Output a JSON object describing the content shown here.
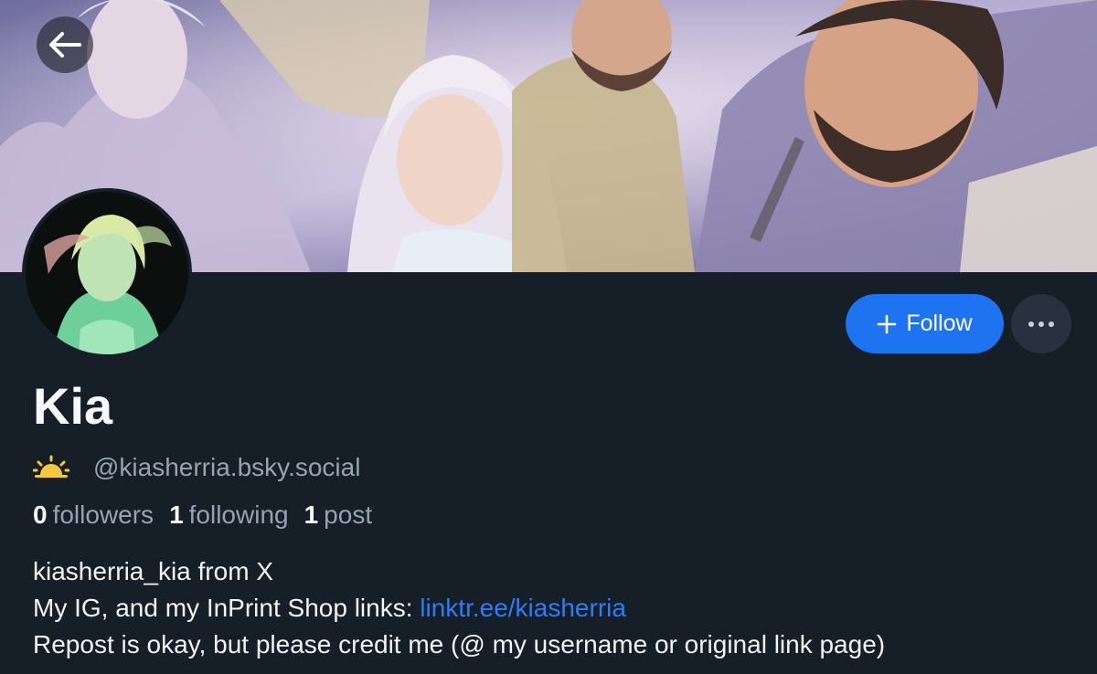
{
  "nav": {
    "back_icon": "arrow-left-icon"
  },
  "banner": {
    "description_icon": "banner-image"
  },
  "profile": {
    "display_name": "Kia",
    "handle_icon": "sun-badge-icon",
    "handle": "@kiasherria.bsky.social",
    "stats": {
      "followers_count": "0",
      "followers_label": "followers",
      "following_count": "1",
      "following_label": "following",
      "posts_count": "1",
      "posts_label": "post"
    },
    "bio": {
      "line1": "kiasherria_kia from X",
      "line2_prefix": "My IG, and my InPrint Shop links: ",
      "line2_link": "linktr.ee/kiasherria",
      "line3": "Repost is okay, but please credit me (@ my username or original link page)"
    }
  },
  "actions": {
    "follow_label": "Follow",
    "follow_icon": "plus-icon",
    "more_icon": "more-horizontal-icon"
  },
  "colors": {
    "background": "#161e27",
    "accent": "#1d73f0",
    "link": "#2f7df6",
    "muted_text": "#96a3b2",
    "sun_badge": "#f5c842"
  }
}
